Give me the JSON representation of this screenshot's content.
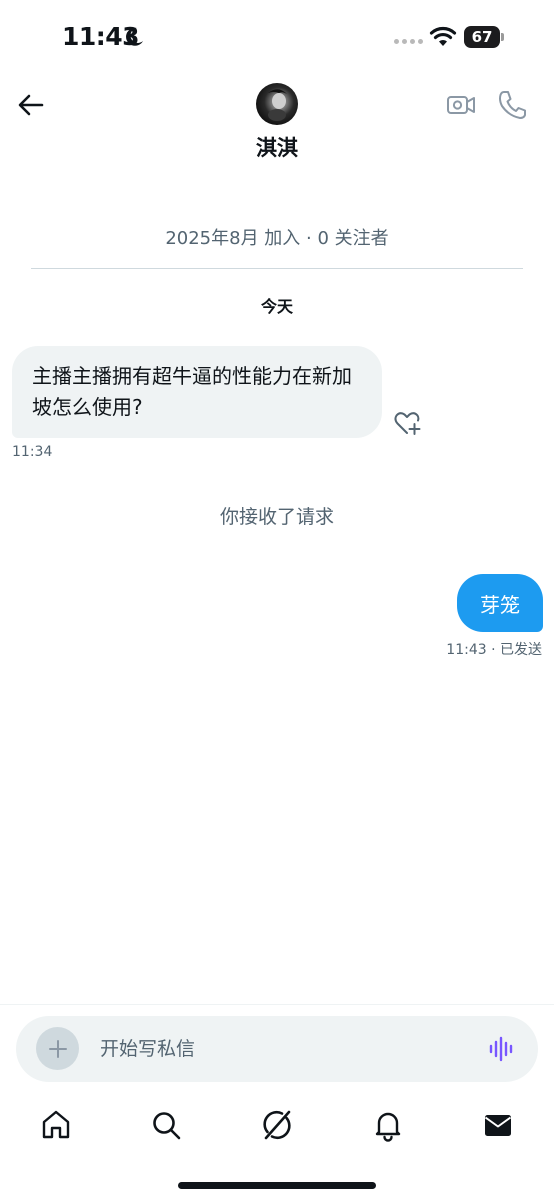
{
  "status_bar": {
    "time": "11:43",
    "battery_level": "67",
    "icons": [
      "moon-icon",
      "signal-dots-icon",
      "wifi-icon",
      "battery-icon"
    ]
  },
  "header": {
    "contact_name": "淇淇",
    "icons": [
      "back-arrow-icon",
      "video-call-icon",
      "phone-call-icon"
    ]
  },
  "profile_info": {
    "joined": "2025年8月 加入",
    "separator": "·",
    "followers": "0 关注者"
  },
  "conversation": {
    "day_label": "今天",
    "incoming": {
      "text": "主播主播拥有超牛逼的性能力在新加坡怎么使用?",
      "time": "11:34"
    },
    "system_notice": "你接收了请求",
    "outgoing": {
      "text": "芽笼",
      "time": "11:43",
      "status": "· 已发送"
    }
  },
  "composer": {
    "placeholder": "开始写私信",
    "icons": [
      "plus-icon",
      "voice-wave-icon"
    ]
  },
  "tab_bar": {
    "tabs": [
      "home-icon",
      "search-icon",
      "grok-icon",
      "notifications-icon",
      "messages-icon"
    ],
    "active": "messages-icon"
  },
  "colors": {
    "accent": "#1d9bf0",
    "secondary_text": "#536471",
    "bubble_in": "#eff3f4",
    "voice_icon": "#7856ff"
  }
}
